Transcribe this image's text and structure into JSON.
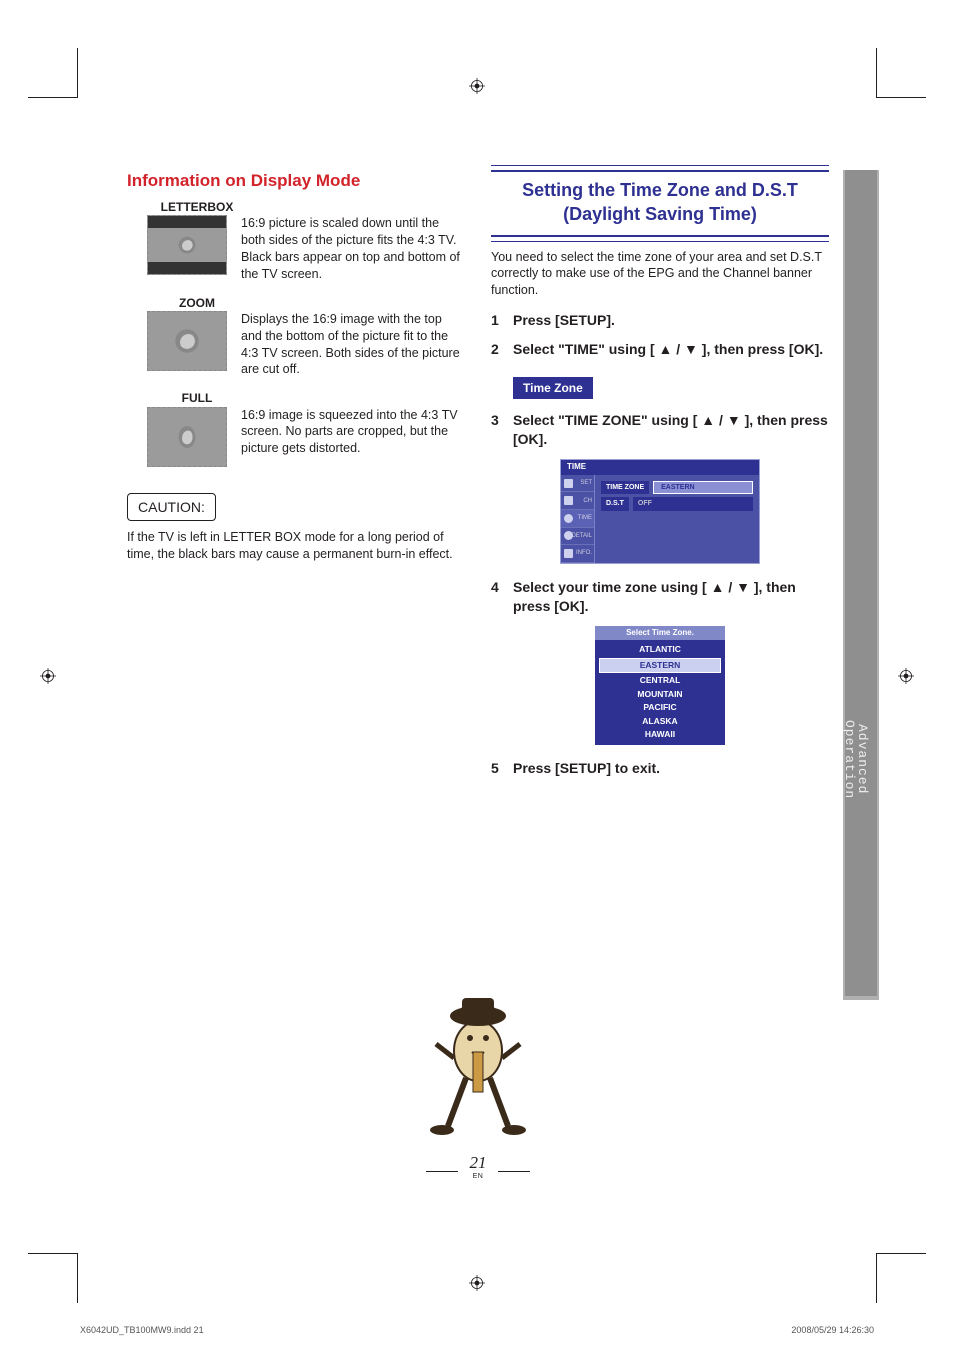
{
  "side_tab": {
    "line1": "Advanced",
    "line2": "Operation"
  },
  "left": {
    "heading": "Information on Display Mode",
    "modes": [
      {
        "label": "LETTERBOX",
        "desc": "16:9 picture is scaled down until the both sides of the picture fits the 4:3 TV. Black bars appear on top and bottom of the TV screen."
      },
      {
        "label": "ZOOM",
        "desc": "Displays the 16:9 image with the top and the bottom of the picture fit to the 4:3 TV screen. Both sides of the picture are cut off."
      },
      {
        "label": "FULL",
        "desc": "16:9 image is squeezed into the 4:3 TV screen. No parts are cropped, but the picture gets distorted."
      }
    ],
    "caution_label": "CAUTION:",
    "caution_text": "If the TV is left in LETTER BOX mode for a long period of time, the black bars may cause a permanent burn-in effect."
  },
  "right": {
    "heading": "Setting the Time Zone and D.S.T (Daylight Saving Time)",
    "intro": "You need to select the time zone of your area and set D.S.T correctly to make use of the EPG and the Channel banner function.",
    "steps": {
      "s1": "Press [SETUP].",
      "s2": "Select \"TIME\" using [ ▲ / ▼ ], then press [OK].",
      "s3": "Select \"TIME ZONE\" using [ ▲ / ▼ ], then press [OK].",
      "s4": "Select your time zone using [ ▲ / ▼ ], then press [OK].",
      "s5": "Press [SETUP] to exit."
    },
    "sub_header": "Time Zone",
    "osd1": {
      "title": "TIME",
      "side": [
        "SET",
        "CH",
        "TIME",
        "DETAIL",
        "INFO."
      ],
      "row1_label": "TIME ZONE",
      "row1_value": "EASTERN",
      "row2_label": "D.S.T",
      "row2_value": "OFF"
    },
    "osd2": {
      "title": "Select Time Zone.",
      "items": [
        "ATLANTIC",
        "EASTERN",
        "CENTRAL",
        "MOUNTAIN",
        "PACIFIC",
        "ALASKA",
        "HAWAII"
      ],
      "selected": "EASTERN"
    }
  },
  "page_number": "21",
  "page_lang": "EN",
  "footer": {
    "left": "X6042UD_TB100MW9.indd   21",
    "right": "2008/05/29   14:26:30"
  }
}
